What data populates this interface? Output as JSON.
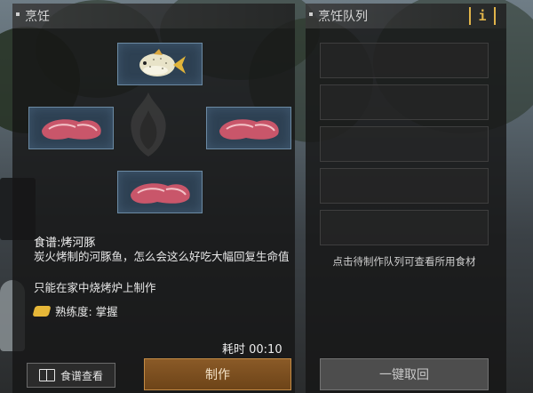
{
  "left_panel": {
    "title": "烹饪"
  },
  "right_panel": {
    "title": "烹饪队列",
    "info_label": "i"
  },
  "recipe": {
    "name": "食谱:烤河豚",
    "description": "炭火烤制的河豚鱼，怎么会这么好吃大幅回复生命值",
    "note": "只能在家中烧烤炉上制作",
    "proficiency": "熟练度: 掌握"
  },
  "timer": "耗时 00:10",
  "buttons": {
    "recipe_book": "食谱查看",
    "craft": "制作",
    "retrieve_all": "一键取回"
  },
  "queue": {
    "hint": "点击待制作队列可查看所用食材",
    "slots": [
      {},
      {},
      {},
      {},
      {}
    ]
  },
  "ingredients": [
    {
      "slot": "top",
      "icon": "pufferfish-icon"
    },
    {
      "slot": "left",
      "icon": "raw-meat-icon"
    },
    {
      "slot": "right",
      "icon": "raw-meat-icon"
    },
    {
      "slot": "bottom",
      "icon": "raw-meat-icon"
    }
  ]
}
